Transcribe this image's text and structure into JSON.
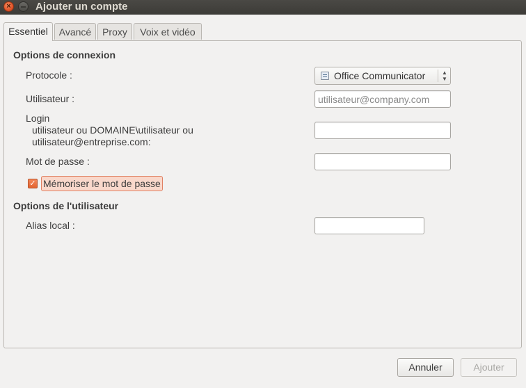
{
  "window": {
    "title": "Ajouter un compte"
  },
  "tabs": [
    {
      "label": "Essentiel"
    },
    {
      "label": "Avancé"
    },
    {
      "label": "Proxy"
    },
    {
      "label": "Voix et vidéo"
    }
  ],
  "connection": {
    "section_title": "Options de connexion",
    "protocol_label": "Protocole :",
    "protocol_value": "Office Communicator",
    "user_label": "Utilisateur :",
    "user_placeholder": "utilisateur@company.com",
    "login_label": "Login",
    "login_hint_1": "utilisateur  ou  DOMAINE\\utilisateur  ou",
    "login_hint_2": "utilisateur@entreprise.com:",
    "login_value": "",
    "password_label": "Mot de passe :",
    "password_value": "",
    "remember_label": "Mémoriser le mot de passe"
  },
  "user_options": {
    "section_title": "Options de l'utilisateur",
    "alias_label": "Alias local :",
    "alias_value": ""
  },
  "buttons": {
    "cancel": "Annuler",
    "add": "Ajouter"
  }
}
